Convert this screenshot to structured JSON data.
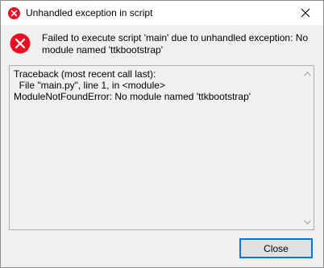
{
  "window": {
    "title": "Unhandled exception in script"
  },
  "message": {
    "text": "Failed to execute script 'main' due to unhandled exception: No module named 'ttkbootstrap'"
  },
  "details": {
    "lines": [
      "Traceback (most recent call last):",
      "  File \"main.py\", line 1, in <module>",
      "ModuleNotFoundError: No module named 'ttkbootstrap'"
    ]
  },
  "footer": {
    "close_label": "Close"
  },
  "icons": {
    "title": "error-icon",
    "message": "error-icon",
    "window_close": "close-icon",
    "scroll_up": "chevron-up-icon",
    "scroll_down": "chevron-down-icon"
  },
  "colors": {
    "error_red": "#e81123",
    "accent_blue": "#0078d7",
    "window_bg": "#f0f0f0",
    "titlebar_bg": "#ffffff"
  }
}
